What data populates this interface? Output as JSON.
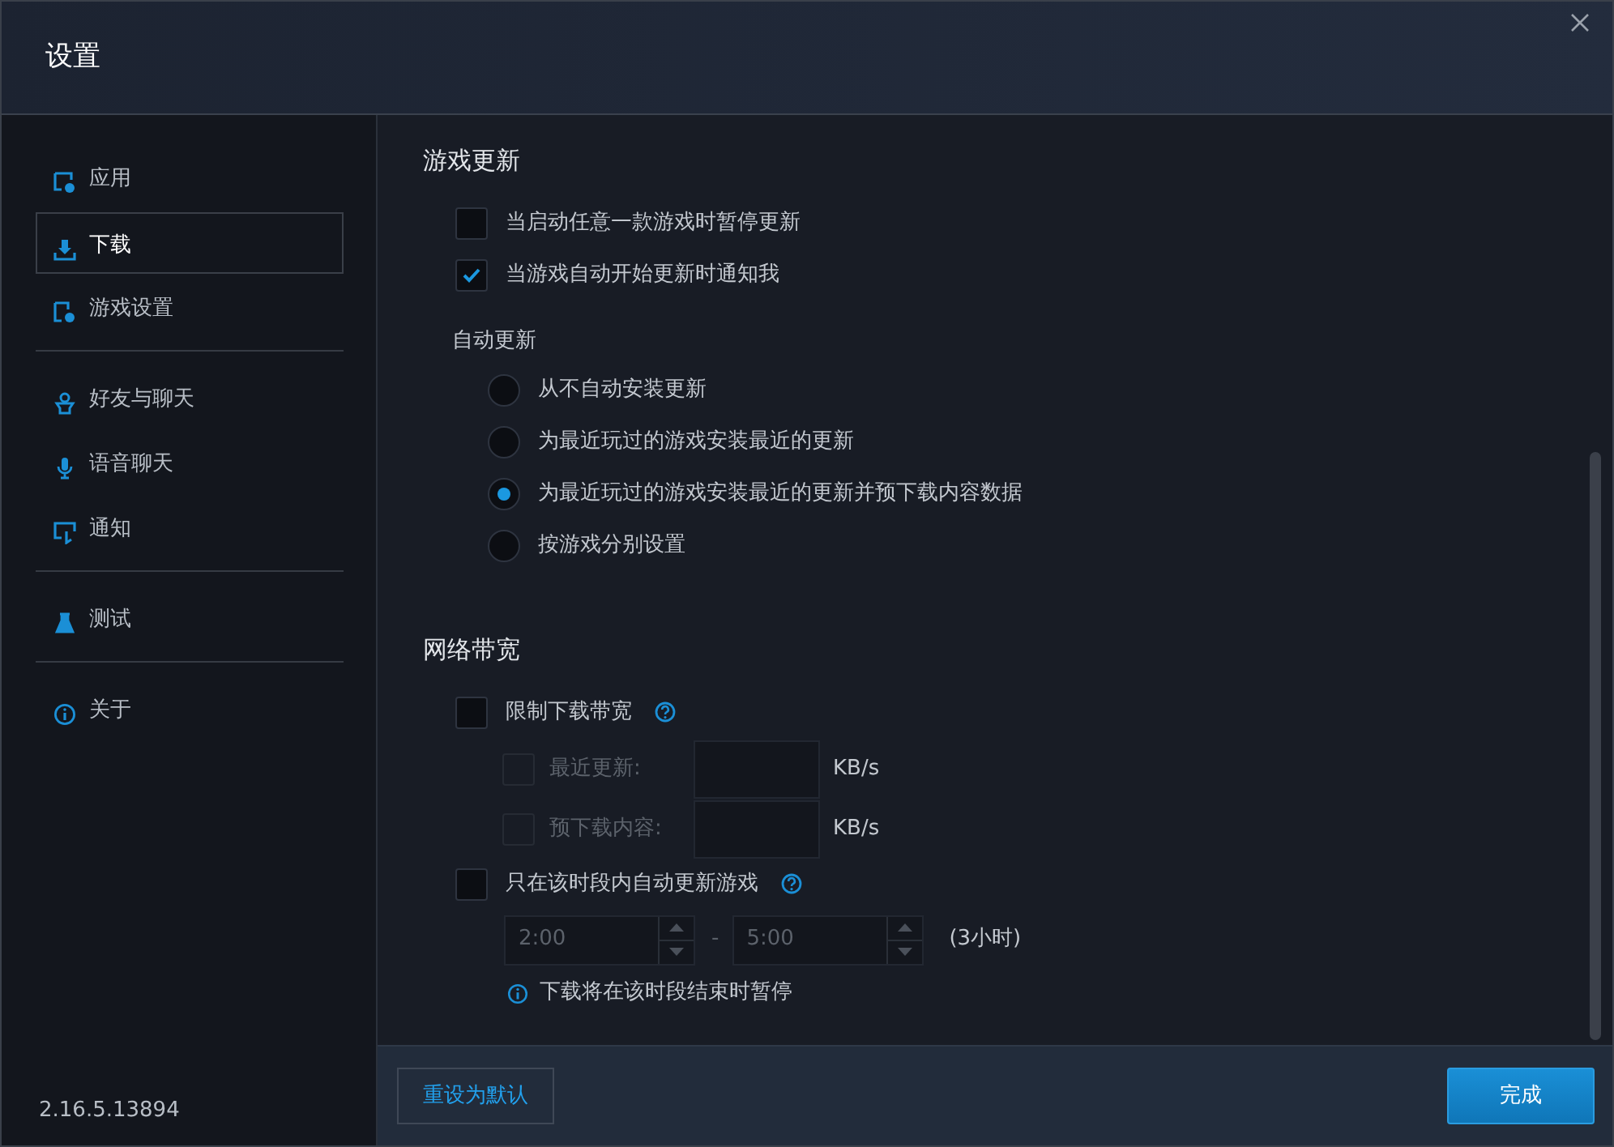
{
  "window": {
    "title": "设置"
  },
  "sidebar": {
    "groups": [
      {
        "items": [
          {
            "label": "应用",
            "kind": "app",
            "selected": false
          },
          {
            "label": "下载",
            "kind": "download",
            "selected": true
          },
          {
            "label": "游戏设置",
            "kind": "game",
            "selected": false
          }
        ]
      },
      {
        "items": [
          {
            "label": "好友与聊天",
            "kind": "friends",
            "selected": false
          },
          {
            "label": "语音聊天",
            "kind": "voice",
            "selected": false
          },
          {
            "label": "通知",
            "kind": "notify",
            "selected": false
          }
        ]
      },
      {
        "items": [
          {
            "label": "测试",
            "kind": "test",
            "selected": false
          }
        ]
      },
      {
        "items": [
          {
            "label": "关于",
            "kind": "about",
            "selected": false
          }
        ]
      }
    ],
    "version": "2.16.5.13894"
  },
  "sections": [
    {
      "title": "游戏更新",
      "items": [
        {
          "kind": "checkbox",
          "label": "当启动任意一款游戏时暂停更新",
          "checked": false
        },
        {
          "kind": "checkbox",
          "label": "当游戏自动开始更新时通知我",
          "checked": true
        },
        {
          "kind": "group_label",
          "label": "自动更新"
        },
        {
          "kind": "radio",
          "label": "从不自动安装更新",
          "selected": false
        },
        {
          "kind": "radio",
          "label": "为最近玩过的游戏安装最近的更新",
          "selected": false
        },
        {
          "kind": "radio",
          "label": "为最近玩过的游戏安装最近的更新并预下载内容数据",
          "selected": true
        },
        {
          "kind": "radio",
          "label": "按游戏分别设置",
          "selected": false
        }
      ]
    },
    {
      "title": "网络带宽",
      "items": [
        {
          "kind": "checkbox",
          "label": "限制下载带宽",
          "checked": false,
          "help": true
        },
        {
          "kind": "rate",
          "label": "最近更新:",
          "unit": "KB/s",
          "checked": false,
          "disabled": true
        },
        {
          "kind": "rate",
          "label": "预下载内容:",
          "unit": "KB/s",
          "checked": false,
          "disabled": true
        },
        {
          "kind": "checkbox",
          "label": "只在该时段内自动更新游戏",
          "checked": false,
          "help": true
        },
        {
          "kind": "time_range",
          "start": "2:00",
          "separator": "-",
          "end": "5:00",
          "duration": "(3小时)"
        },
        {
          "kind": "info",
          "text": "下载将在该时段结束时暂停"
        }
      ]
    }
  ],
  "footer": {
    "reset_button": "重设为默认",
    "done_button": "完成"
  }
}
